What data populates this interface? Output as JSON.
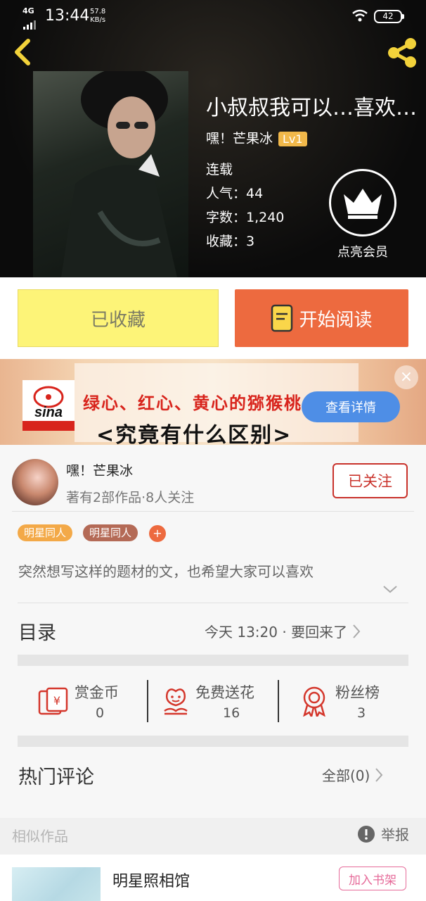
{
  "status_bar": {
    "network": "4G",
    "time": "13:44",
    "speed_value": "57.8",
    "speed_unit": "KB/s",
    "battery": "42"
  },
  "book": {
    "title": "小叔叔我可以…喜欢…",
    "author": "嘿！芒果冰",
    "level_badge": "Lv1",
    "status": "连载",
    "popularity": "人气：44",
    "word_count": "字数：1,240",
    "collections": "收藏：3",
    "vip_label": "点亮会员"
  },
  "actions": {
    "collected_label": "已收藏",
    "read_label": "开始阅读"
  },
  "ad": {
    "brand": "sina",
    "line1": "绿心、红心、黄心的猕猴桃",
    "line2": "<究竟有什么区别>",
    "detail_button": "查看详情",
    "close": "×"
  },
  "author_card": {
    "name": "嘿！芒果冰",
    "info": "著有2部作品·8人关注",
    "follow_label": "已关注",
    "tags": [
      "明星同人",
      "明星同人"
    ],
    "add_tag": "+",
    "description": "突然想写这样的题材的文，也希望大家可以喜欢"
  },
  "catalog": {
    "title": "目录",
    "latest": "今天 13:20 · 要回来了"
  },
  "stats": {
    "reward_label": "赏金币",
    "reward_value": "0",
    "flower_label": "免费送花",
    "flower_value": "16",
    "fans_label": "粉丝榜",
    "fans_value": "3"
  },
  "comments": {
    "title": "热门评论",
    "all_label": "全部(0)"
  },
  "similar": {
    "title": "相似作品",
    "report_label": "举报",
    "books": [
      {
        "name": "明星照相馆",
        "button": "加入书架"
      }
    ]
  },
  "colors": {
    "collected_bg": "#fdf478",
    "read_bg": "#ed6a3f",
    "follow": "#c9322b",
    "tag1": "#f3a948",
    "tag2": "#b46a56",
    "shelf": "#e66b9a"
  }
}
